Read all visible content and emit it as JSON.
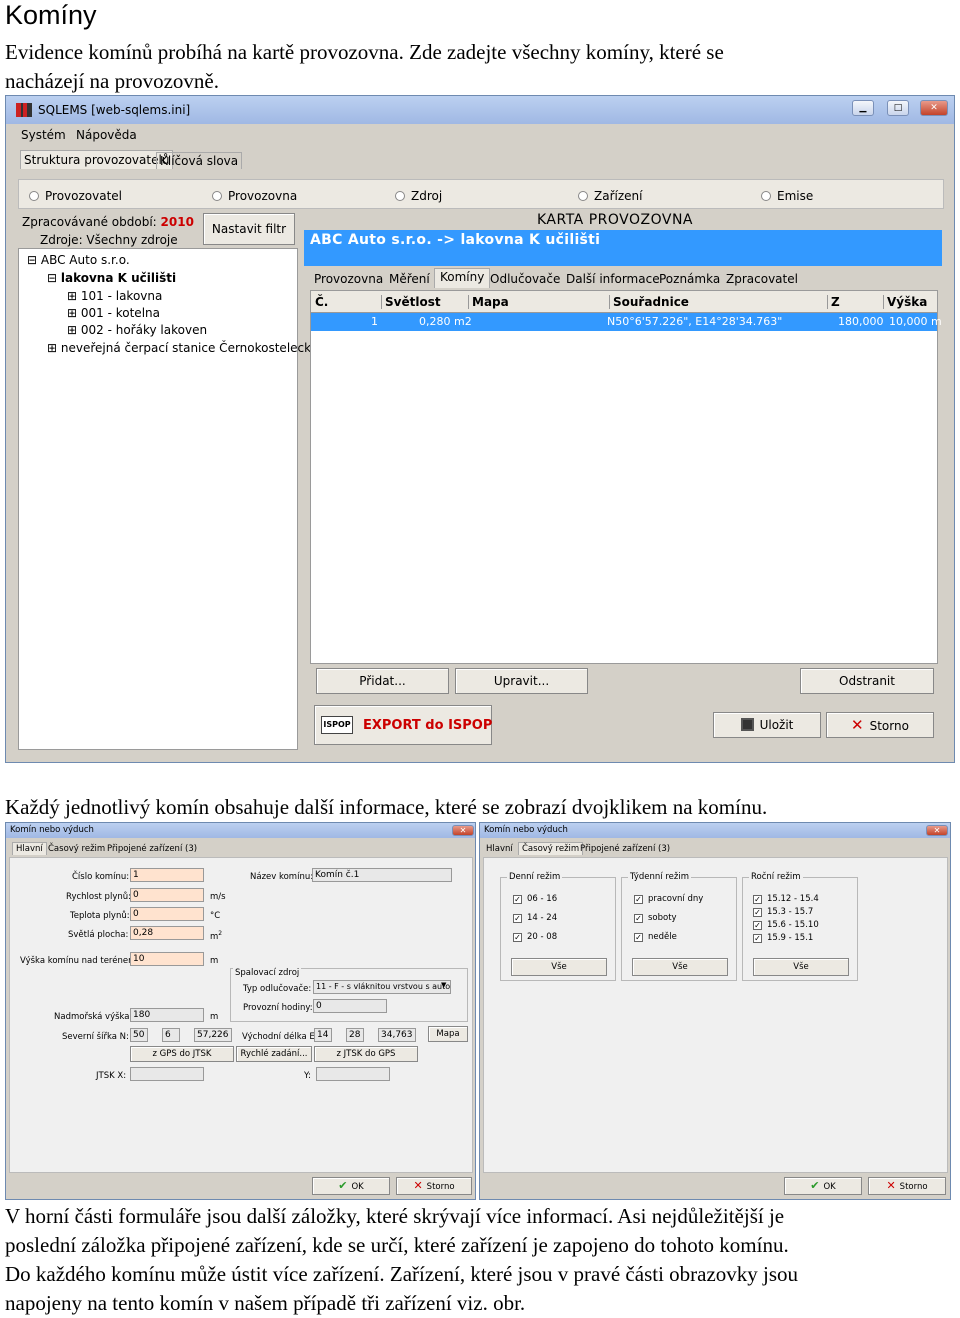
{
  "doc": {
    "heading": "Komíny",
    "intro_lines": [
      "Evidence komínů probíhá na kartě provozovna. Zde zadejte všechny komíny, které se",
      "nacházejí na provozovně."
    ],
    "mid_line": "Každý jednotlivý komín obsahuje další informace, které se zobrazí dvojklikem na komínu.",
    "outro_lines": [
      "V horní části formuláře jsou další záložky, které skrývají více informací. Asi nejdůležitější je",
      "poslední záložka připojené zařízení, kde se určí, které zařízení je zapojeno do tohoto komínu.",
      "Do každého komínu může ústit více zařízení. Zařízení, které jsou v pravé části obrazovky jsou",
      "napojeny na tento komín v našem případě tři zařízení viz. obr."
    ]
  },
  "main_window": {
    "title": "SQLEMS [web-sqlems.ini]",
    "menu": [
      "Systém",
      "Nápověda"
    ],
    "top_tabs": [
      "Struktura provozovatelů",
      "Klíčová slova"
    ],
    "radios": [
      "Provozovatel",
      "Provozovna",
      "Zdroj",
      "Zařízení",
      "Emise"
    ],
    "period_label": "Zpracovávané období:",
    "period_value": "2010",
    "sources_label": "Zdroje: Všechny zdroje",
    "filter_button": "Nastavit filtr",
    "tree": [
      "ABC Auto s.r.o.",
      "lakovna K učilišti",
      "101 - lakovna",
      "001 - kotelna",
      "002 - hořáky lakoven",
      "neveřejná čerpací stanice Černokostelecká"
    ],
    "card_title": "KARTA PROVOZOVNA",
    "card_path": "ABC Auto s.r.o. -> lakovna K učilišti",
    "card_tabs": [
      "Provozovna",
      "Měření",
      "Komíny",
      "Odlučovače",
      "Další informace",
      "Poznámka",
      "Zpracovatel"
    ],
    "table_headers": [
      "Č.",
      "Světlost",
      "Mapa",
      "Souřadnice",
      "Z",
      "Výška"
    ],
    "table_row": [
      "1",
      "0,280 m2",
      "",
      "N50°6'57.226\", E14°28'34.763\"",
      "180,000",
      "10,000 m"
    ],
    "buttons": {
      "add": "Přidat...",
      "edit": "Upravit...",
      "remove": "Odstranit",
      "export": "EXPORT do ISPOP",
      "ispop_logo": "ISPOP",
      "save": "Uložit",
      "cancel": "Storno"
    }
  },
  "dialog_left": {
    "title": "Komín nebo výduch",
    "tabs": [
      "Hlavní",
      "Časový režim",
      "Připojené zařízení (3)"
    ],
    "chimney_number_label": "Číslo komínu:",
    "chimney_number": "1",
    "chimney_name_label": "Název komínu:",
    "chimney_name": "Komín č.1",
    "gas_speed_label": "Rychlost plynů:",
    "gas_speed": "0",
    "gas_speed_unit": "m/s",
    "gas_temp_label": "Teplota plynů:",
    "gas_temp": "0",
    "gas_temp_unit": "°C",
    "area_label": "Světlá plocha:",
    "area": "0,28",
    "area_unit": "m",
    "height_label": "Výška komínu nad terénem:",
    "height": "10",
    "height_unit": "m",
    "combustion_group": "Spalovací zdroj",
    "separator_type_label": "Typ odlučovače:",
    "separator_type": "11 - F - s vláknitou vrstvou s auto",
    "hours_label": "Provozní hodiny:",
    "hours": "0",
    "altitude_label": "Nadmořská výška:",
    "altitude": "180",
    "altitude_unit": "m",
    "lat_label": "Severní šířka N:",
    "lat_deg": "50",
    "lat_min": "6",
    "lat_sec": "57,226",
    "lon_label": "Východní délka E:",
    "lon_deg": "14",
    "lon_min": "28",
    "lon_sec": "34,763",
    "map_button": "Mapa",
    "gps_jtsk_button": "z GPS do JTSK",
    "quick_button": "Rychlé zadání...",
    "jtsk_gps_button": "z JTSK do GPS",
    "jtsk_x_label": "JTSK X:",
    "y_label": "Y:",
    "ok": "OK",
    "cancel": "Storno"
  },
  "dialog_right": {
    "title": "Komín nebo výduch",
    "tabs": [
      "Hlavní",
      "Časový režim",
      "Připojené zařízení (3)"
    ],
    "daily_group": "Denní režim",
    "daily": [
      "06 - 16",
      "14 - 24",
      "20 - 08"
    ],
    "weekly_group": "Týdenní režim",
    "weekly": [
      "pracovní dny",
      "soboty",
      "neděle"
    ],
    "yearly_group": "Roční režim",
    "yearly": [
      "15.12 - 15.4",
      "15.3 - 15.7",
      "15.6 - 15.10",
      "15.9 - 15.1"
    ],
    "all_button": "Vše",
    "ok": "OK",
    "cancel": "Storno"
  },
  "colors": {
    "selection": "#3399ff",
    "accent_red": "#cc0000",
    "title_bar": "#a0b8e4"
  }
}
